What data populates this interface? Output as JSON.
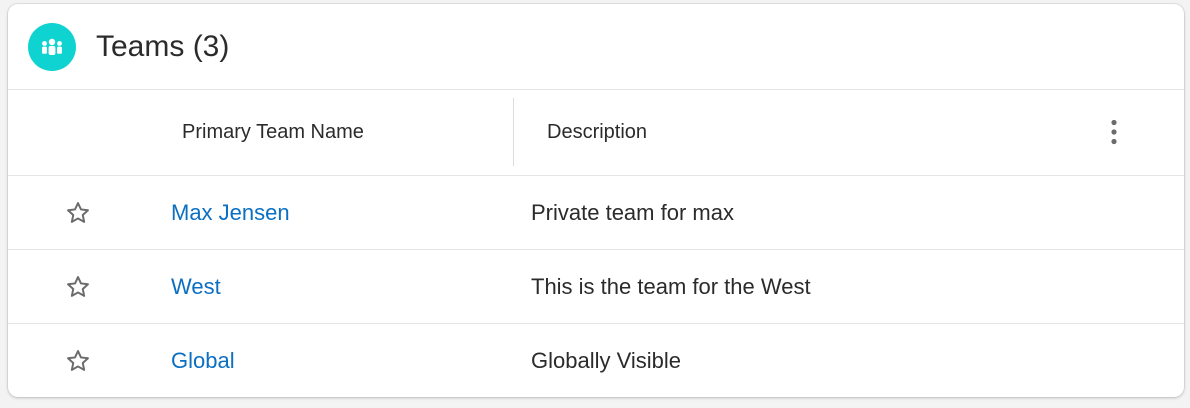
{
  "card": {
    "title": "Teams (3)",
    "icon": "team-icon",
    "icon_color": "#0fd3d0"
  },
  "columns": {
    "name": "Primary Team Name",
    "description": "Description"
  },
  "menu_icon": "vertical-dots-icon",
  "rows": [
    {
      "name": "Max Jensen",
      "description": "Private team for max",
      "favorite_icon": "star-outline-icon"
    },
    {
      "name": "West",
      "description": "This is the team for the West",
      "favorite_icon": "star-outline-icon"
    },
    {
      "name": "Global",
      "description": "Globally Visible",
      "favorite_icon": "star-outline-icon"
    }
  ],
  "colors": {
    "link": "#0b6fc2",
    "text": "#2b2b2b",
    "divider": "#e5e5e5"
  }
}
